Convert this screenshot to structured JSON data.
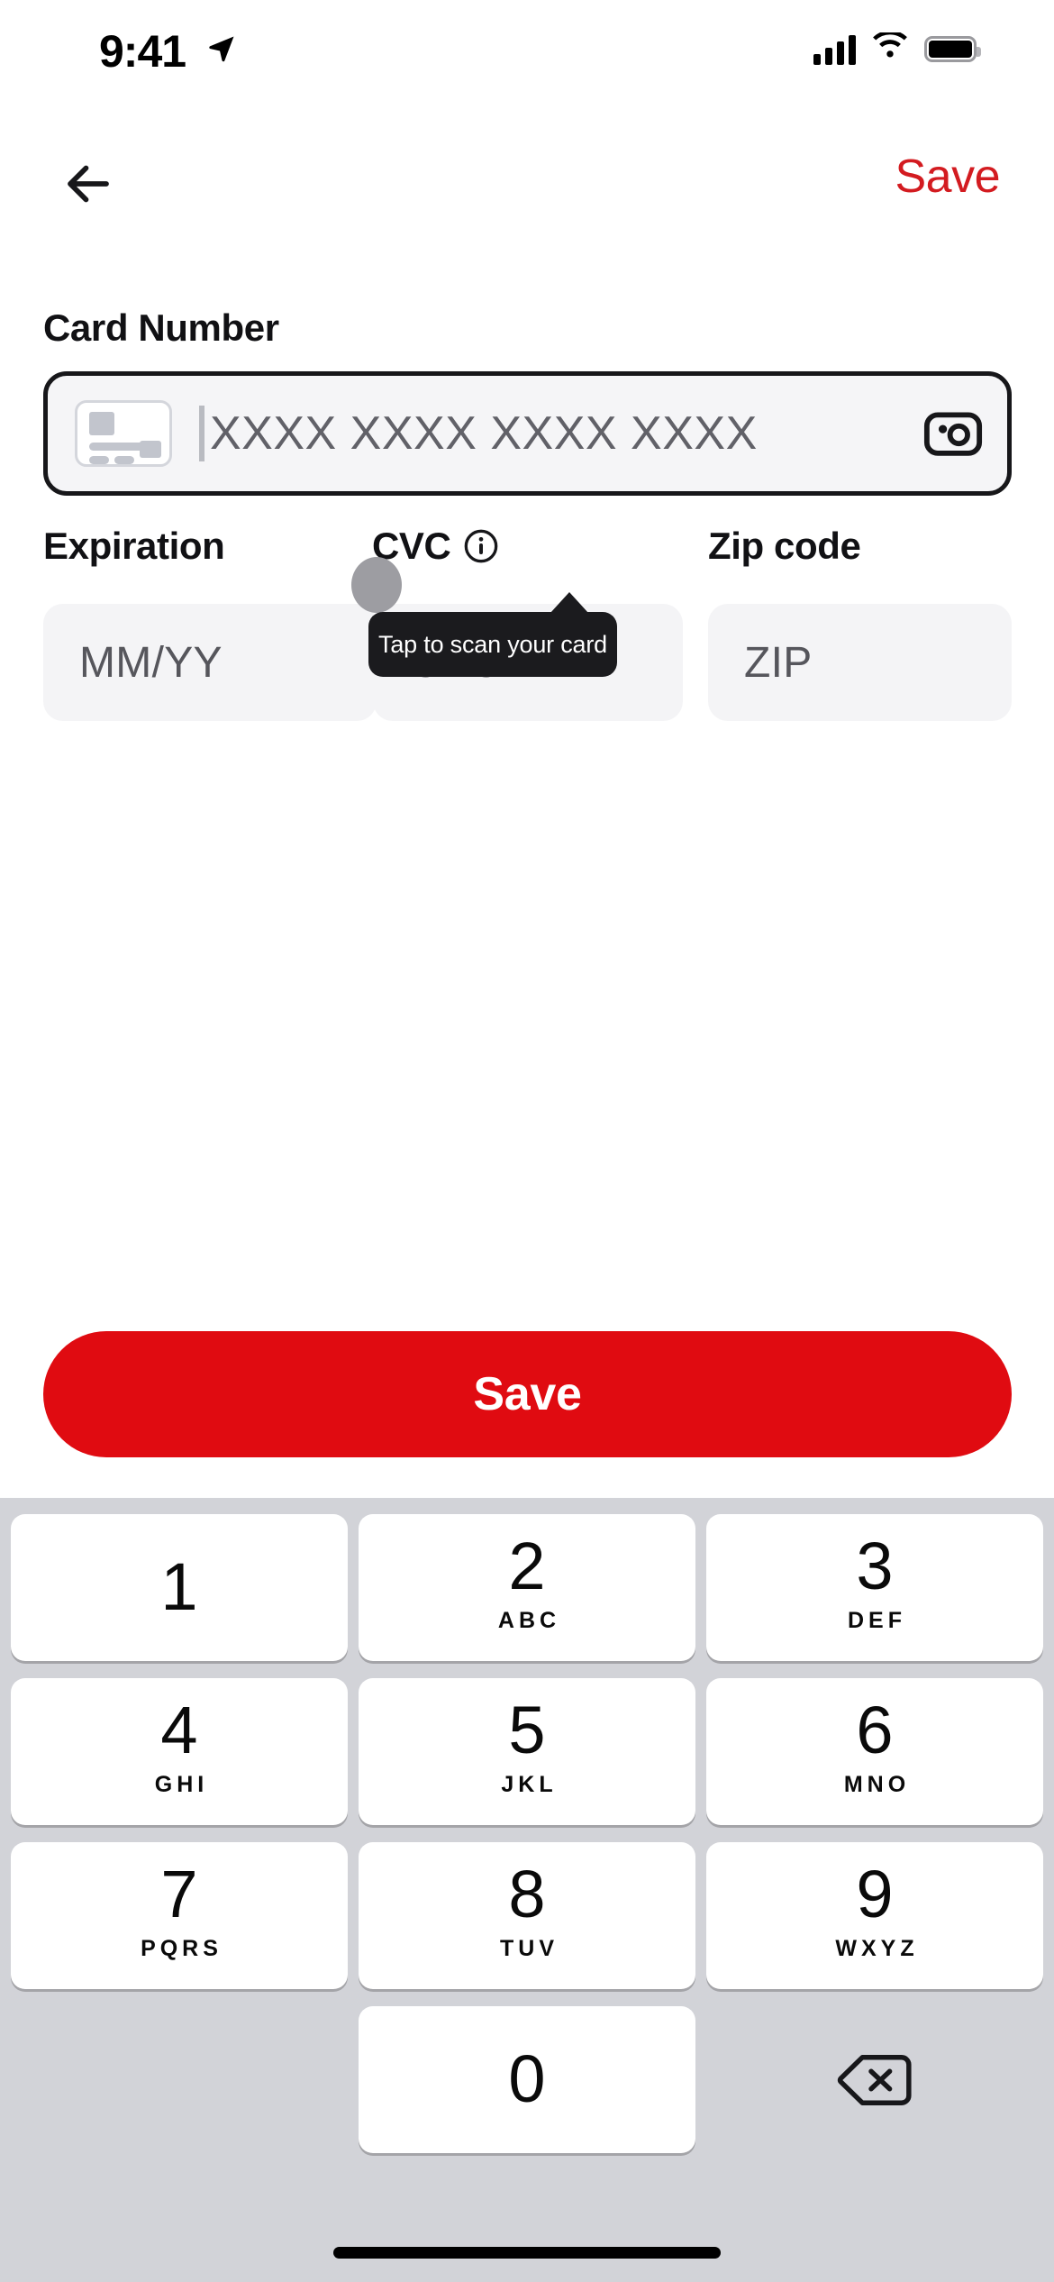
{
  "status_bar": {
    "time": "9:41",
    "location_icon": "location-arrow-icon",
    "cellular_icon": "cellular-bars-icon",
    "wifi_icon": "wifi-icon",
    "battery_icon": "battery-full-icon"
  },
  "nav": {
    "back_icon": "back-arrow-icon",
    "save_label": "Save"
  },
  "form": {
    "card_number": {
      "label": "Card Number",
      "placeholder": "XXXX XXXX XXXX XXXX",
      "value": "",
      "card_thumb_icon": "credit-card-icon",
      "scan_icon": "camera-scan-icon"
    },
    "expiration": {
      "label": "Expiration",
      "placeholder": "MM/YY",
      "value": ""
    },
    "cvc": {
      "label": "CVC",
      "placeholder": "CVC",
      "value": "",
      "info_icon": "info-circle-icon"
    },
    "zip": {
      "label": "Zip code",
      "placeholder": "ZIP",
      "value": ""
    }
  },
  "tooltip": {
    "text": "Tap to scan your card"
  },
  "primary_button": {
    "label": "Save"
  },
  "keypad": {
    "keys": [
      {
        "num": "1",
        "letters": ""
      },
      {
        "num": "2",
        "letters": "ABC"
      },
      {
        "num": "3",
        "letters": "DEF"
      },
      {
        "num": "4",
        "letters": "GHI"
      },
      {
        "num": "5",
        "letters": "JKL"
      },
      {
        "num": "6",
        "letters": "MNO"
      },
      {
        "num": "7",
        "letters": "PQRS"
      },
      {
        "num": "8",
        "letters": "TUV"
      },
      {
        "num": "9",
        "letters": "WXYZ"
      },
      {
        "num": "0",
        "letters": ""
      }
    ],
    "delete_icon": "backspace-delete-icon"
  },
  "colors": {
    "accent_red": "#E00B11",
    "link_red": "#D31B20",
    "tooltip_bg": "#1B1B1E",
    "field_bg": "#F4F4F6",
    "keyboard_bg": "#D2D3D8"
  }
}
